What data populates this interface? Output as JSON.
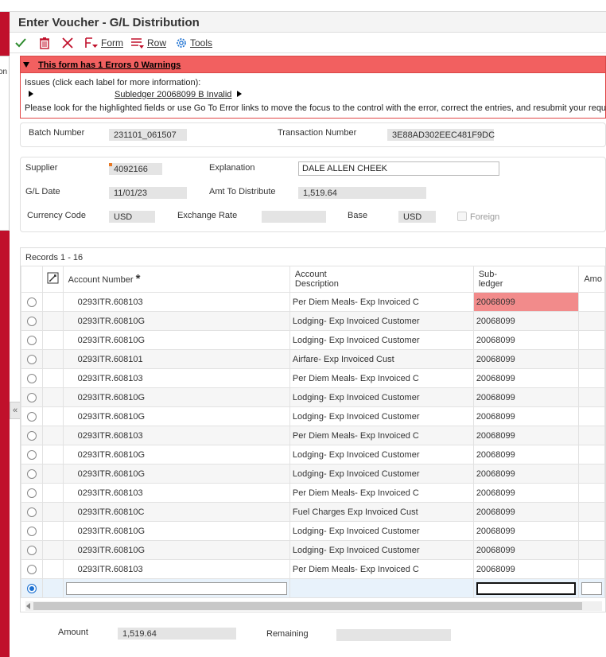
{
  "sidebar": {
    "tab_text": "on",
    "collapse_glyph": "«"
  },
  "header": {
    "title": "Enter Voucher - G/L Distribution"
  },
  "toolbar": {
    "ok_icon": "check-icon",
    "delete_icon": "trash-icon",
    "cancel_icon": "close-icon",
    "form_label": "Form",
    "row_label": "Row",
    "tools_label": "Tools"
  },
  "errors": {
    "summary": "This form has 1 Errors 0 Warnings",
    "issues_label": "Issues (click each label for more information):",
    "issue_link": "Subledger 20068099 B Invalid",
    "hint": "Please look for the highlighted fields or use Go To Error links to move the focus to the control with the error, correct the entries, and resubmit your requ"
  },
  "batch": {
    "batch_label": "Batch Number",
    "batch_value": "231101_061507",
    "txn_label": "Transaction Number",
    "txn_value": "3E88AD302EEC481F9DC"
  },
  "voucher": {
    "supplier_label": "Supplier",
    "supplier_value": "4092166",
    "explanation_label": "Explanation",
    "explanation_value": "DALE ALLEN CHEEK",
    "gl_date_label": "G/L Date",
    "gl_date_value": "11/01/23",
    "amt_label": "Amt To Distribute",
    "amt_value": "1,519.64",
    "currency_label": "Currency Code",
    "currency_value": "USD",
    "exchange_label": "Exchange Rate",
    "exchange_value": "",
    "base_label": "Base",
    "base_value": "USD",
    "foreign_label": "Foreign"
  },
  "grid": {
    "records_label": "Records 1 - 16",
    "col_account": "Account Number",
    "col_account_required": "*",
    "col_desc_1": "Account",
    "col_desc_2": "Description",
    "col_sub_1": "Sub-",
    "col_sub_2": "ledger",
    "col_amount": "Amo",
    "rows": [
      {
        "account": "0293ITR.608103",
        "desc": "Per Diem Meals- Exp Invoiced C",
        "sub": "20068099"
      },
      {
        "account": "0293ITR.60810G",
        "desc": "Lodging- Exp Invoiced Customer",
        "sub": "20068099"
      },
      {
        "account": "0293ITR.60810G",
        "desc": "Lodging- Exp Invoiced Customer",
        "sub": "20068099"
      },
      {
        "account": "0293ITR.608101",
        "desc": "Airfare- Exp Invoiced Cust",
        "sub": "20068099"
      },
      {
        "account": "0293ITR.608103",
        "desc": "Per Diem Meals- Exp Invoiced C",
        "sub": "20068099"
      },
      {
        "account": "0293ITR.60810G",
        "desc": "Lodging- Exp Invoiced Customer",
        "sub": "20068099"
      },
      {
        "account": "0293ITR.60810G",
        "desc": "Lodging- Exp Invoiced Customer",
        "sub": "20068099"
      },
      {
        "account": "0293ITR.608103",
        "desc": "Per Diem Meals- Exp Invoiced C",
        "sub": "20068099"
      },
      {
        "account": "0293ITR.60810G",
        "desc": "Lodging- Exp Invoiced Customer",
        "sub": "20068099"
      },
      {
        "account": "0293ITR.60810G",
        "desc": "Lodging- Exp Invoiced Customer",
        "sub": "20068099"
      },
      {
        "account": "0293ITR.608103",
        "desc": "Per Diem Meals- Exp Invoiced C",
        "sub": "20068099"
      },
      {
        "account": "0293ITR.60810C",
        "desc": "Fuel Charges Exp Invoiced Cust",
        "sub": "20068099"
      },
      {
        "account": "0293ITR.60810G",
        "desc": "Lodging- Exp Invoiced Customer",
        "sub": "20068099"
      },
      {
        "account": "0293ITR.60810G",
        "desc": "Lodging- Exp Invoiced Customer",
        "sub": "20068099"
      },
      {
        "account": "0293ITR.608103",
        "desc": "Per Diem Meals- Exp Invoiced C",
        "sub": "20068099"
      }
    ]
  },
  "footer": {
    "amount_label": "Amount",
    "amount_value": "1,519.64",
    "remaining_label": "Remaining",
    "remaining_value": ""
  },
  "colors": {
    "brand_red": "#c0102b",
    "error_red": "#f26060",
    "error_cell": "#f28b8b",
    "accent_blue": "#1a6fd1"
  }
}
